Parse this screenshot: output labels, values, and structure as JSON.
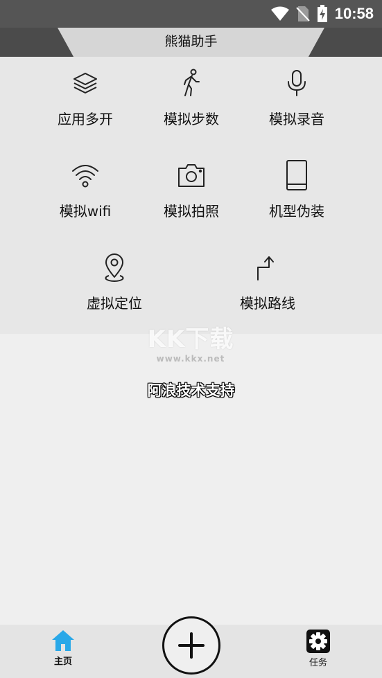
{
  "status_bar": {
    "time": "10:58",
    "icons": [
      "wifi-icon",
      "no-sim-icon",
      "battery-charging-icon"
    ]
  },
  "header": {
    "title": "熊猫助手"
  },
  "features": [
    {
      "label": "应用多开",
      "icon": "layers-icon"
    },
    {
      "label": "模拟步数",
      "icon": "walking-person-icon"
    },
    {
      "label": "模拟录音",
      "icon": "microphone-icon"
    },
    {
      "label": "模拟wifi",
      "icon": "wifi-icon"
    },
    {
      "label": "模拟拍照",
      "icon": "camera-icon"
    },
    {
      "label": "机型伪装",
      "icon": "tablet-icon"
    },
    {
      "label": "虚拟定位",
      "icon": "location-pin-icon"
    },
    {
      "label": "模拟路线",
      "icon": "route-arrow-icon"
    }
  ],
  "watermark": {
    "logo": "KK下载",
    "url": "www.kkx.net"
  },
  "support_text": "阿浪技术支持",
  "bottom_nav": {
    "home_label": "主页",
    "task_label": "任务",
    "fab_icon": "plus-icon",
    "active_color": "#29a8e8"
  }
}
